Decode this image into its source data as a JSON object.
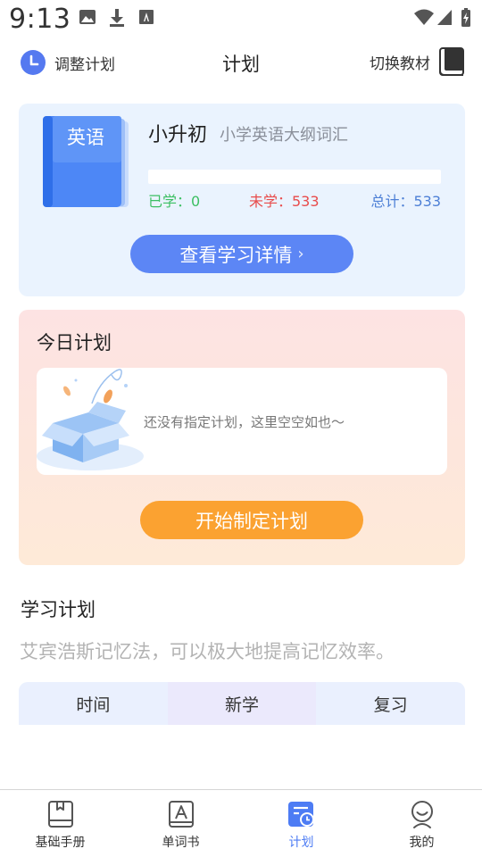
{
  "status_bar": {
    "time": "9:13",
    "icons": [
      "image-icon",
      "download-icon",
      "font-icon",
      "wifi-icon",
      "signal-icon",
      "battery-icon"
    ]
  },
  "header": {
    "adjust_plan_label": "调整计划",
    "title": "计划",
    "switch_book_label": "切换教材"
  },
  "book": {
    "cover_tag": "英语",
    "level": "小升初",
    "name": "小学英语大纲词汇",
    "learned_text": "已学：0",
    "unlearned_text": "未学：533",
    "total_text": "总计：533",
    "learned": 0,
    "total": 533,
    "details_button": "查看学习详情"
  },
  "today_plan": {
    "title": "今日计划",
    "empty_message": "还没有指定计划，这里空空如也～",
    "start_button": "开始制定计划"
  },
  "study_plan": {
    "title": "学习计划",
    "description": "艾宾浩斯记忆法，可以极大地提高记忆效率。",
    "columns": [
      "时间",
      "新学",
      "复习"
    ]
  },
  "tab_bar": {
    "tabs": [
      {
        "label": "基础手册",
        "icon": "handbook-icon"
      },
      {
        "label": "单词书",
        "icon": "wordbook-icon"
      },
      {
        "label": "计划",
        "icon": "plan-icon"
      },
      {
        "label": "我的",
        "icon": "profile-icon"
      }
    ],
    "active_index": 2
  },
  "colors": {
    "accent": "#4d7cf4",
    "book_card_bg": "#eaf3fe",
    "details_button": "#5c86f5",
    "start_button": "#fba231",
    "learned": "#3cbf63",
    "unlearned": "#e84b4b",
    "total": "#4d7fd6"
  }
}
